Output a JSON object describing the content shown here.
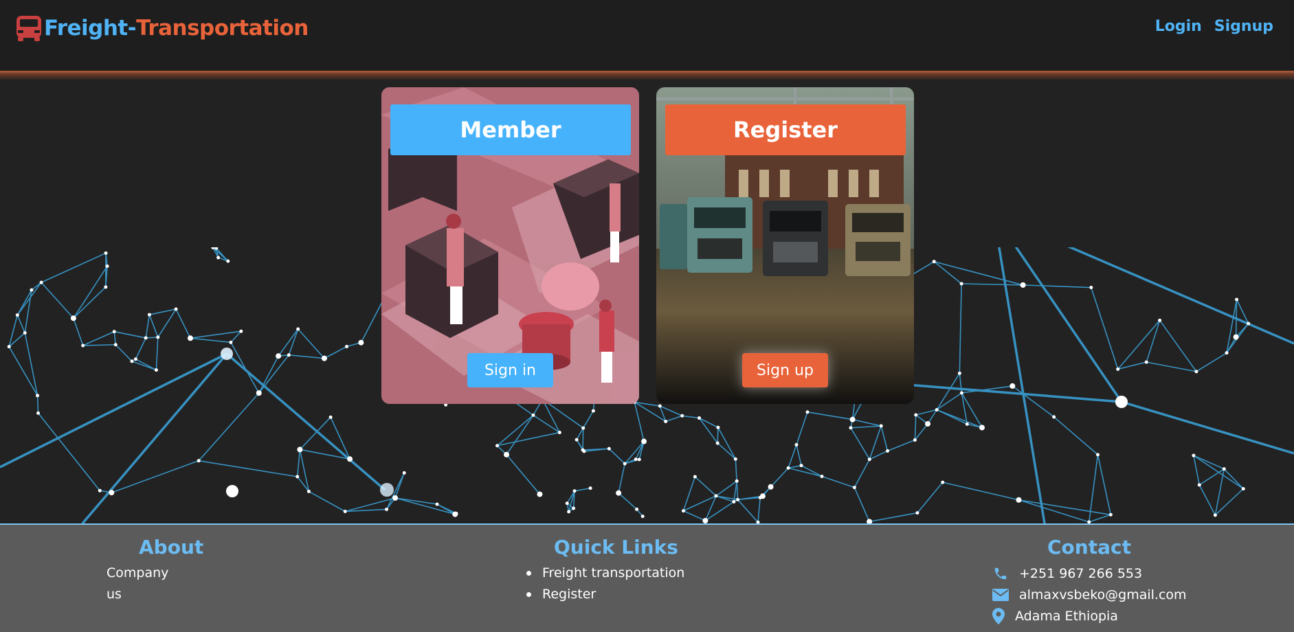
{
  "header": {
    "brand_part1": "Freight-",
    "brand_part2": "Transportation",
    "brand_icon": "truck-icon",
    "nav": {
      "login": "Login",
      "signup": "Signup"
    }
  },
  "cards": {
    "member": {
      "title": "Member",
      "button": "Sign in"
    },
    "register": {
      "title": "Register",
      "button": "Sign up"
    }
  },
  "footer": {
    "about": {
      "heading": "About",
      "lines": [
        "Company",
        "us"
      ]
    },
    "quick_links": {
      "heading": "Quick Links",
      "items": [
        "Freight transportation",
        "Register"
      ]
    },
    "contact": {
      "heading": "Contact",
      "phone": "+251 967 266 553",
      "email": "almaxvsbeko@gmail.com",
      "location": "Adama Ethiopia",
      "icons": [
        "phone-icon",
        "envelope-icon",
        "map-pin-icon"
      ]
    }
  },
  "colors": {
    "accent_blue": "#45b2fb",
    "accent_orange": "#e8633a",
    "background": "#222222",
    "footer": "#5b5b5b"
  }
}
